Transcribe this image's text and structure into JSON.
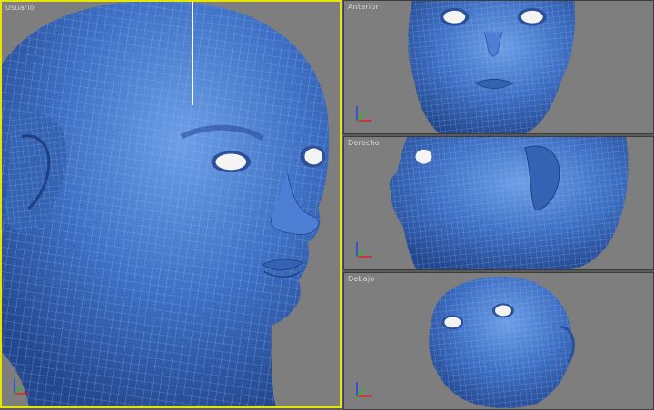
{
  "viewports": {
    "perspective": {
      "label": "Usuario",
      "active": true
    },
    "front": {
      "label": "Anterior",
      "active": false
    },
    "right": {
      "label": "Derecho",
      "active": false
    },
    "bottom": {
      "label": "Debajo",
      "active": false
    }
  },
  "colors": {
    "viewport_bg": "#7e7e7e",
    "active_border": "#e6e600",
    "mesh_fill": "#3f72c6",
    "mesh_wire": "#8fb8f0",
    "eye": "#f4f4f4"
  },
  "icons": [
    "axis-tripod-icon"
  ]
}
